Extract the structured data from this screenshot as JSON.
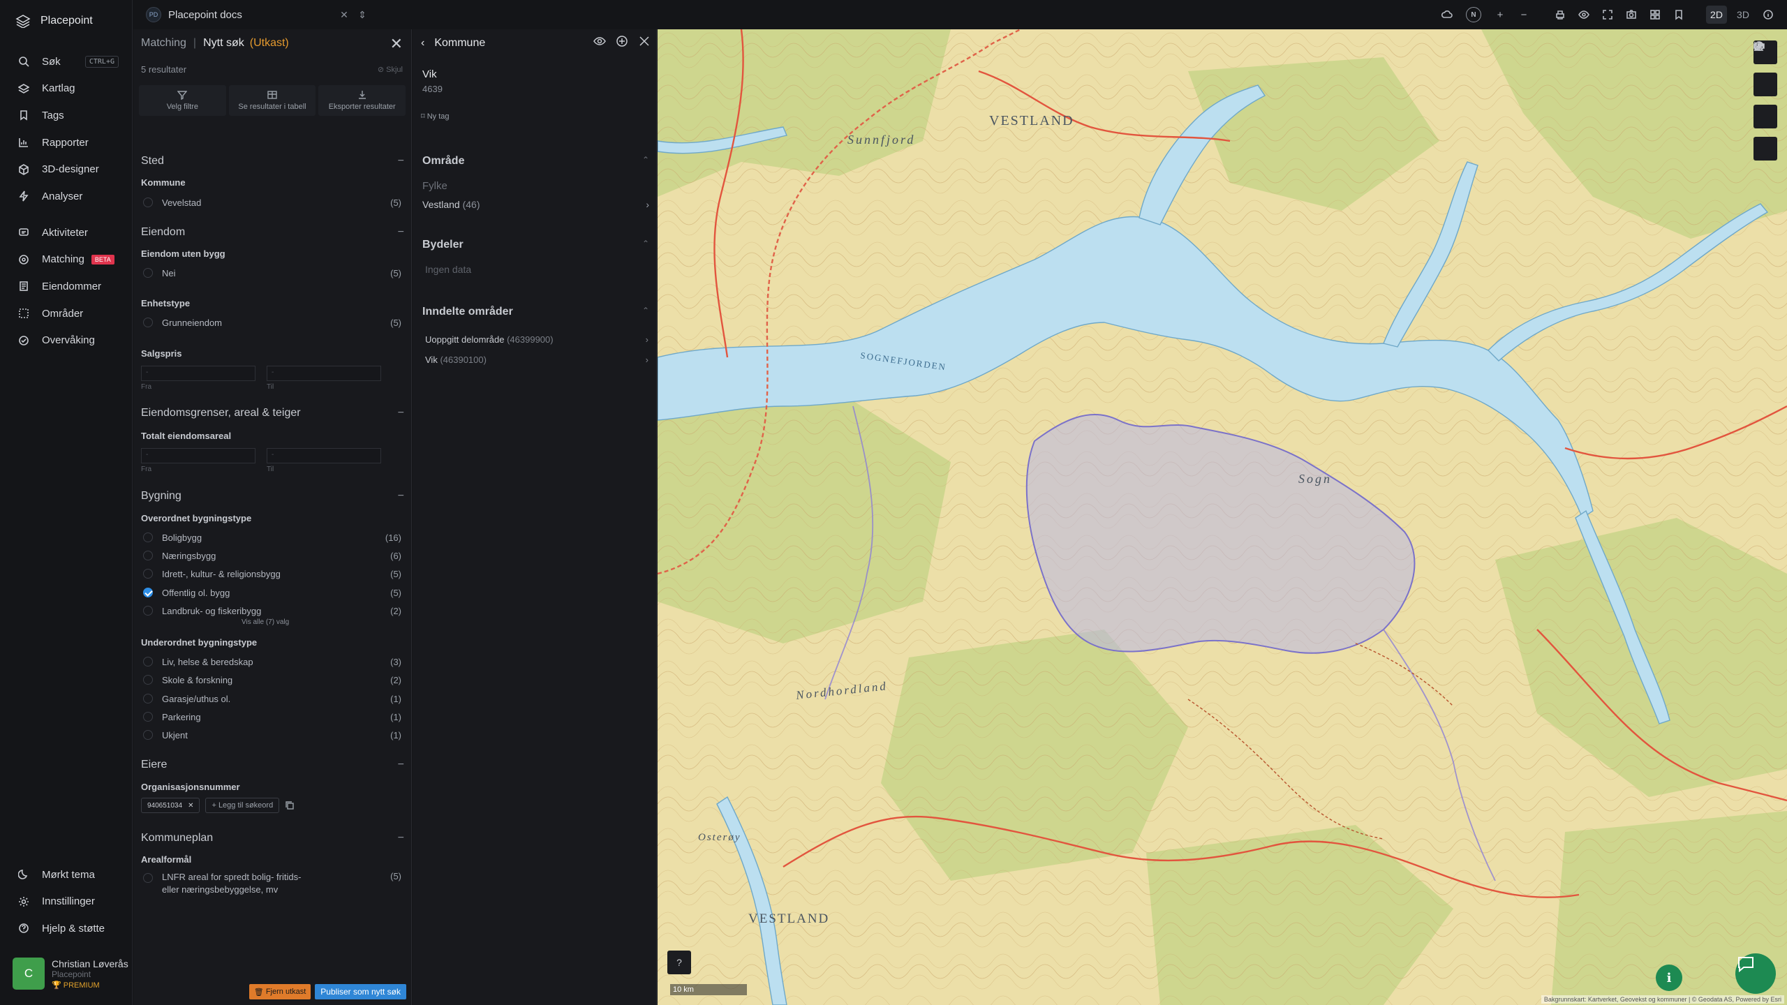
{
  "app": {
    "name": "Placepoint"
  },
  "workspace": {
    "badge": "PD",
    "name": "Placepoint docs"
  },
  "toolbar": {
    "compass": "N",
    "zoom_in": "+",
    "zoom_out": "−",
    "mode_2d": "2D",
    "mode_3d": "3D",
    "active_mode": "2D"
  },
  "sidebar": {
    "items": [
      {
        "label": "Søk",
        "shortcut": "CTRL+G",
        "icon": "search-icon"
      },
      {
        "label": "Kartlag",
        "icon": "layers-icon"
      },
      {
        "label": "Tags",
        "icon": "bookmark-icon"
      },
      {
        "label": "Rapporter",
        "icon": "chart-icon"
      },
      {
        "label": "3D-designer",
        "icon": "cube-icon"
      },
      {
        "label": "Analyser",
        "icon": "bolt-icon"
      },
      {
        "label": "Aktiviteter",
        "icon": "activity-icon"
      },
      {
        "label": "Matching",
        "badge": "BETA",
        "icon": "matching-icon"
      },
      {
        "label": "Eiendommer",
        "icon": "document-icon"
      },
      {
        "label": "Områder",
        "icon": "area-icon"
      },
      {
        "label": "Overvåking",
        "icon": "watch-icon"
      }
    ],
    "bottom": [
      {
        "label": "Mørkt tema",
        "icon": "moon-icon"
      },
      {
        "label": "Innstillinger",
        "icon": "gear-icon"
      },
      {
        "label": "Hjelp & støtte",
        "icon": "help-icon"
      }
    ],
    "user": {
      "initial": "C",
      "name": "Christian Løverås",
      "org": "Placepoint",
      "plan": "PREMIUM"
    }
  },
  "search": {
    "title_prefix": "Matching",
    "title": "Nytt søk",
    "draft": "(Utkast)",
    "results": "5 resultater",
    "hide": "Skjul",
    "actions": [
      "Velg filtre",
      "Se resultater i tabell",
      "Eksporter resultater"
    ],
    "sections": {
      "sted": "Sted",
      "kommune": "Kommune",
      "kommune_opt": {
        "label": "Vevelstad",
        "count": "(5)"
      },
      "eiendom": "Eiendom",
      "uten_bygg": "Eiendom uten bygg",
      "uten_bygg_opt": {
        "label": "Nei",
        "count": "(5)"
      },
      "enhetstype": "Enhetstype",
      "enhetstype_opt": {
        "label": "Grunneiendom",
        "count": "(5)"
      },
      "salgspris": "Salgspris",
      "grenser": "Eiendomsgrenser, areal & teiger",
      "totalt_areal": "Totalt eiendomsareal",
      "bygning": "Bygning",
      "overordnet": "Overordnet bygningstype",
      "overordnet_opts": [
        {
          "label": "Boligbygg",
          "count": "(16)",
          "checked": false
        },
        {
          "label": "Næringsbygg",
          "count": "(6)",
          "checked": false
        },
        {
          "label": "Idrett-, kultur- & religionsbygg",
          "count": "(5)",
          "checked": false
        },
        {
          "label": "Offentlig ol. bygg",
          "count": "(5)",
          "checked": true
        },
        {
          "label": "Landbruk- og fiskeribygg",
          "count": "(2)",
          "checked": false
        }
      ],
      "show_all": "Vis alle (7) valg",
      "underordnet": "Underordnet bygningstype",
      "underordnet_opts": [
        {
          "label": "Liv, helse & beredskap",
          "count": "(3)"
        },
        {
          "label": "Skole & forskning",
          "count": "(2)"
        },
        {
          "label": "Garasje/uthus ol.",
          "count": "(1)"
        },
        {
          "label": "Parkering",
          "count": "(1)"
        },
        {
          "label": "Ukjent",
          "count": "(1)"
        }
      ],
      "eiere": "Eiere",
      "orgnr": "Organisasjonsnummer",
      "orgnr_chip": "940651034",
      "add_keyword": "Legg til søkeord",
      "kommuneplan": "Kommuneplan",
      "arealformal": "Arealformål",
      "arealformal_opt": {
        "label_1": "LNFR areal for spredt bolig- fritids-",
        "label_2": "eller næringsbebyggelse, mv",
        "count": "(5)"
      }
    },
    "range_placeholder": "-",
    "range_from": "Fra",
    "range_to": "Til",
    "remove_draft": "Fjern utkast",
    "publish": "Publiser som nytt søk"
  },
  "detail": {
    "title": "Kommune",
    "name": "Vik",
    "code": "4639",
    "new_tag": "Ny tag",
    "omrade": "Område",
    "fylke_label": "Fylke",
    "fylke_value": "Vestland",
    "fylke_count": "(46)",
    "bydeler": "Bydeler",
    "no_data": "Ingen data",
    "inndelte": "Inndelte områder",
    "subareas": [
      {
        "name": "Uoppgitt delområde",
        "code": "(46399900)"
      },
      {
        "name": "Vik",
        "code": "(46390100)"
      }
    ]
  },
  "map": {
    "labels": [
      "VESTLAND",
      "Sunnfjord",
      "SOGNEFJORDEN",
      "Sogn",
      "Nordhordland",
      "VESTLAND",
      "Osterøy"
    ],
    "scale": "10 km",
    "attribution": "Bakgrunnskart: Kartverket, Geovekst og kommuner | © Geodata AS, Powered by Esri",
    "colors": {
      "water": "#bcdff0",
      "land": "#ecdfa8",
      "forest": "#c9d58a",
      "highlight": "#b9b6e3"
    }
  }
}
